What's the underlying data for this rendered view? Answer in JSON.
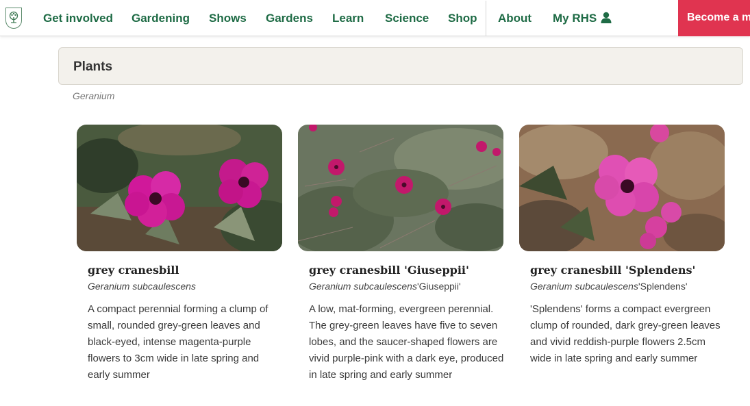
{
  "nav": {
    "items": [
      {
        "label": "Get involved"
      },
      {
        "label": "Gardening"
      },
      {
        "label": "Shows"
      },
      {
        "label": "Gardens"
      },
      {
        "label": "Learn"
      },
      {
        "label": "Science"
      },
      {
        "label": "Shop"
      },
      {
        "label": "About"
      },
      {
        "label": "My RHS"
      }
    ],
    "cta_label": "Become a m",
    "accent": "#1e6b45",
    "cta_color": "#e03450"
  },
  "section": {
    "title": "Plants",
    "subtitle": "Geranium"
  },
  "cards": [
    {
      "title": "grey cranesbill",
      "latin": "Geranium subcaulescens",
      "cultivar": "",
      "description": "A compact perennial forming a clump of small, rounded grey-green leaves and black-eyed, intense magenta-purple flowers to 3cm wide in late spring and early summer"
    },
    {
      "title": "grey cranesbill 'Giuseppii'",
      "latin": "Geranium subcaulescens",
      "cultivar": "'Giuseppii'",
      "description": "A low, mat-forming, evergreen perennial. The grey-green leaves have five to seven lobes, and the saucer-shaped flowers are vivid purple-pink with a dark eye, produced in late spring and early summer"
    },
    {
      "title": "grey cranesbill 'Splendens'",
      "latin": "Geranium subcaulescens",
      "cultivar": "'Splendens'",
      "description": "'Splendens' forms a compact evergreen clump of rounded, dark grey-green leaves and vivid reddish-purple flowers 2.5cm wide in late spring and early summer"
    }
  ]
}
